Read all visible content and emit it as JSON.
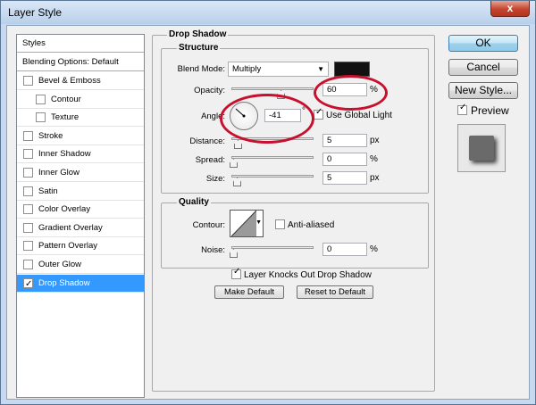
{
  "window": {
    "title": "Layer Style",
    "close_glyph": "x"
  },
  "left_list": {
    "header": "Styles",
    "blending": "Blending Options: Default",
    "items": [
      {
        "label": "Bevel & Emboss",
        "checked": false
      },
      {
        "label": "Contour",
        "checked": false,
        "sub": true
      },
      {
        "label": "Texture",
        "checked": false,
        "sub": true
      },
      {
        "label": "Stroke",
        "checked": false
      },
      {
        "label": "Inner Shadow",
        "checked": false
      },
      {
        "label": "Inner Glow",
        "checked": false
      },
      {
        "label": "Satin",
        "checked": false
      },
      {
        "label": "Color Overlay",
        "checked": false
      },
      {
        "label": "Gradient Overlay",
        "checked": false
      },
      {
        "label": "Pattern Overlay",
        "checked": false
      },
      {
        "label": "Outer Glow",
        "checked": false
      },
      {
        "label": "Drop Shadow",
        "checked": true,
        "selected": true
      }
    ]
  },
  "panel": {
    "title": "Drop Shadow",
    "structure": {
      "title": "Structure",
      "blend_mode_label": "Blend Mode:",
      "blend_mode_value": "Multiply",
      "shadow_color": "#111111",
      "opacity_label": "Opacity:",
      "opacity_value": "60",
      "opacity_level": 60,
      "percent": "%",
      "angle_label": "Angle:",
      "angle_value": "-41",
      "degree": "°",
      "global_light_label": "Use Global Light",
      "global_light_checked": true,
      "distance_label": "Distance:",
      "distance_value": "5",
      "spread_label": "Spread:",
      "spread_value": "0",
      "size_label": "Size:",
      "size_value": "5",
      "px": "px"
    },
    "quality": {
      "title": "Quality",
      "contour_label": "Contour:",
      "anti_aliased_label": "Anti-aliased",
      "noise_label": "Noise:",
      "noise_value": "0"
    },
    "knocks_out_label": "Layer Knocks Out Drop Shadow",
    "make_default_label": "Make Default",
    "reset_default_label": "Reset to Default"
  },
  "right": {
    "ok_label": "OK",
    "cancel_label": "Cancel",
    "new_style_label": "New Style...",
    "preview_label": "Preview",
    "preview_checked": true
  },
  "annotation_color": "#c8102e"
}
